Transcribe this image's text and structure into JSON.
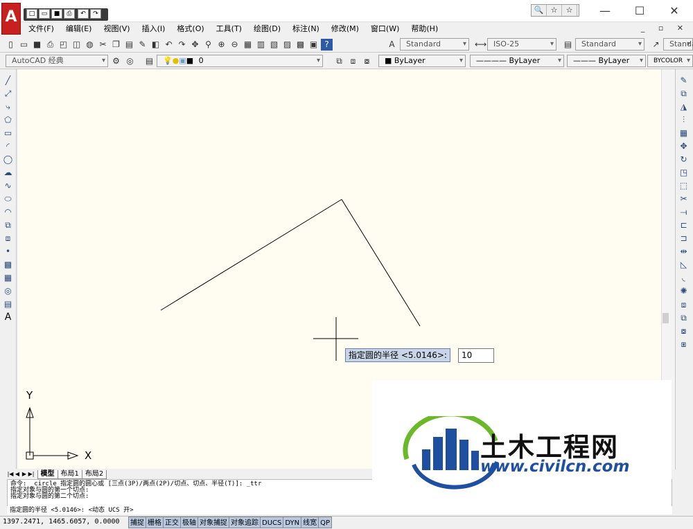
{
  "app": {
    "logo_letter": "A"
  },
  "quick_access": [
    "□",
    "▭",
    "■",
    "⎙",
    "↶",
    "↷"
  ],
  "search_icons": [
    "🔍",
    "☆",
    "☆"
  ],
  "window_controls": {
    "minimize": "—",
    "maximize": "☐",
    "close": "✕"
  },
  "menu": [
    "文件(F)",
    "编辑(E)",
    "视图(V)",
    "插入(I)",
    "格式(O)",
    "工具(T)",
    "绘图(D)",
    "标注(N)",
    "修改(M)",
    "窗口(W)",
    "帮助(H)"
  ],
  "doc_controls": "_ ▫ ✕",
  "toolbar1": {
    "text_style": "Standard",
    "dim_style": "ISO-25",
    "table_style": "Standard",
    "multileader_style": "Standa"
  },
  "toolbar2": {
    "workspace": "AutoCAD 经典",
    "layer": "0",
    "color": "ByLayer",
    "linetype": "ByLayer",
    "lineweight": "ByLayer",
    "plotstyle": "BYCOLOR"
  },
  "canvas": {
    "prompt_label": "指定圆的半径 <5.0146>:",
    "prompt_value": "10",
    "ucs_x": "X",
    "ucs_y": "Y"
  },
  "tabs": [
    "模型",
    "布局1",
    "布局2"
  ],
  "command_lines": [
    "命令: _circle 指定圆的圆心或 [三点(3P)/两点(2P)/切点、切点、半径(T)]: _ttr",
    "指定对象与圆的第一个切点:",
    "指定对象与圆的第二个切点:",
    "指定圆的半径 <5.0146>: <动态 UCS 开>"
  ],
  "status": {
    "coords": "1397.2471, 1465.6057, 0.0000",
    "toggles": [
      "捕捉",
      "栅格",
      "正交",
      "极轴",
      "对象捕捉",
      "对象追踪",
      "DUCS",
      "DYN",
      "线宽",
      "QP"
    ]
  },
  "watermark": {
    "brand": "土木工程网",
    "url": "www.civilcn.com",
    "color_blue": "#1f4fa0",
    "color_green": "#6bb82a"
  }
}
